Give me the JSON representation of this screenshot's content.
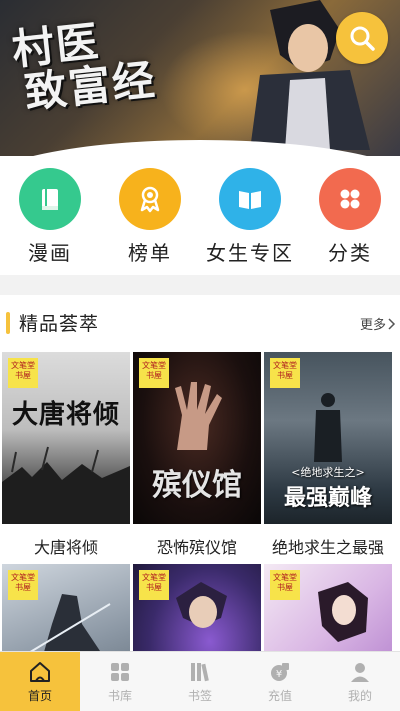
{
  "banner": {
    "title_line1": "村医",
    "title_line2": "致富经",
    "search_icon": "search-icon",
    "accent": "#f6c23c"
  },
  "categories": [
    {
      "label": "漫画",
      "icon": "book-icon",
      "color": "#35c98e"
    },
    {
      "label": "榜单",
      "icon": "ribbon-icon",
      "color": "#f7b21c"
    },
    {
      "label": "女生专区",
      "icon": "open-book-icon",
      "color": "#2fb2e8"
    },
    {
      "label": "分类",
      "icon": "grid-icon",
      "color": "#f26a4f"
    }
  ],
  "section": {
    "title": "精品荟萃",
    "more_label": "更多"
  },
  "books": [
    {
      "title": "大唐将倾",
      "stamp": "文笔堂书屋",
      "cover_text": "大唐将倾"
    },
    {
      "title": "恐怖殡仪馆",
      "stamp": "文笔堂书屋",
      "cover_text": "殡仪馆"
    },
    {
      "title": "绝地求生之最强",
      "stamp": "文笔堂书屋",
      "cover_text": "最强巅峰",
      "cover_subtext": "<绝地求生之>"
    },
    {
      "title": "",
      "stamp": "文笔堂书屋"
    },
    {
      "title": "",
      "stamp": "文笔堂书屋"
    },
    {
      "title": "",
      "stamp": "文笔堂书屋"
    }
  ],
  "tabs": [
    {
      "label": "首页",
      "icon": "home-icon",
      "active": true
    },
    {
      "label": "书库",
      "icon": "library-icon",
      "active": false
    },
    {
      "label": "书签",
      "icon": "bookmark-icon",
      "active": false
    },
    {
      "label": "充值",
      "icon": "recharge-icon",
      "active": false
    },
    {
      "label": "我的",
      "icon": "profile-icon",
      "active": false
    }
  ]
}
